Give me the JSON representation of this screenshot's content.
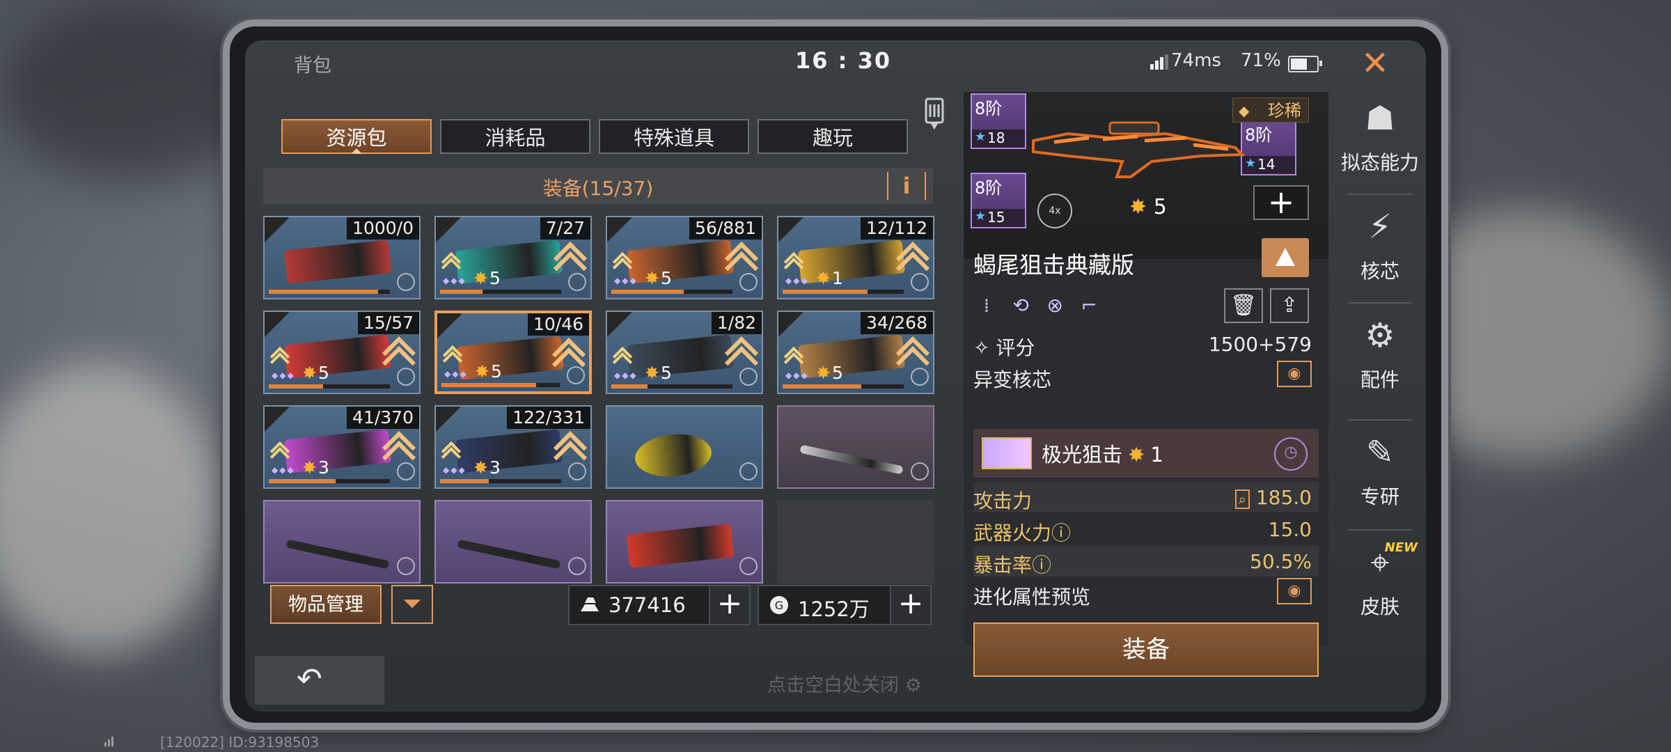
{
  "header": {
    "title": "背包",
    "clock": "16 : 30",
    "ping": "74ms",
    "battery": "71%",
    "battery_level": 0.71
  },
  "tabs": [
    {
      "label": "资源包",
      "active": true
    },
    {
      "label": "消耗品",
      "active": false
    },
    {
      "label": "特殊道具",
      "active": false
    },
    {
      "label": "趣玩",
      "active": false
    }
  ],
  "equipment": {
    "header": "装备(15/37)",
    "info_label": "i",
    "items": [
      {
        "count": "1000/0",
        "stars": "",
        "tier": "blue",
        "weapon": "fire-extinguisher",
        "progress": 0.9,
        "color": "#b53a36"
      },
      {
        "count": "7/27",
        "stars": "5",
        "tier": "blue",
        "weapon": "rifle-teal",
        "progress": 0.35,
        "color": "#2aa39a"
      },
      {
        "count": "56/881",
        "stars": "5",
        "tier": "blue",
        "weapon": "rifle-orange",
        "progress": 0.6,
        "color": "#c9652f"
      },
      {
        "count": "12/112",
        "stars": "1",
        "tier": "blue",
        "weapon": "rifle-gold",
        "progress": 0.7,
        "color": "#d7a530"
      },
      {
        "count": "15/57",
        "stars": "5",
        "tier": "blue",
        "weapon": "rifle-red",
        "progress": 0.45,
        "color": "#d63a3a"
      },
      {
        "count": "10/46",
        "stars": "5",
        "tier": "blue",
        "weapon": "sniper-scorpion",
        "progress": 0.8,
        "color": "#c9652f",
        "selected": true
      },
      {
        "count": "1/82",
        "stars": "5",
        "tier": "blue",
        "weapon": "crossbow-dark",
        "progress": 0.3,
        "color": "#3d4b5a"
      },
      {
        "count": "34/268",
        "stars": "5",
        "tier": "blue",
        "weapon": "rifle-camo",
        "progress": 0.65,
        "color": "#b48148"
      },
      {
        "count": "41/370",
        "stars": "3",
        "tier": "blue",
        "weapon": "rifle-pink",
        "progress": 0.55,
        "color": "#c44bd0"
      },
      {
        "count": "122/331",
        "stars": "3",
        "tier": "blue",
        "weapon": "launcher-blue",
        "progress": 0.4,
        "color": "#2f3c66"
      },
      {
        "count": "",
        "stars": "",
        "tier": "blue",
        "weapon": "disc-saw",
        "progress": 0,
        "color": "#d8bf28"
      },
      {
        "count": "",
        "stars": "",
        "tier": "dim",
        "weapon": "screwdriver",
        "progress": 0,
        "color": "#cfcfcf"
      },
      {
        "count": "",
        "stars": "",
        "tier": "purple",
        "weapon": "hammer",
        "progress": 0,
        "color": "#2a2a2a"
      },
      {
        "count": "",
        "stars": "",
        "tier": "purple",
        "weapon": "hammer",
        "progress": 0,
        "color": "#2a2a2a"
      },
      {
        "count": "",
        "stars": "",
        "tier": "purple",
        "weapon": "chainsaw",
        "progress": 0,
        "color": "#d33a2a"
      },
      {
        "count": "",
        "stars": "",
        "tier": "empty",
        "weapon": "",
        "progress": 0,
        "color": ""
      }
    ]
  },
  "bottom": {
    "manage_label": "物品管理",
    "gold_value": "377416",
    "coin_value": "1252万",
    "plus": "+",
    "dismiss_hint": "点击空白处关闭",
    "back_icon": "undo-icon"
  },
  "detail": {
    "rarity": "珍稀",
    "tiers": [
      {
        "label": "8阶",
        "stars": "18"
      },
      {
        "label": "8阶",
        "stars": "15"
      },
      {
        "label": "8阶",
        "stars": "14"
      }
    ],
    "scope": "4x",
    "star_level": "5",
    "plus": "+",
    "weapon_name": "蝎尾狙击典藏版",
    "score_label": "评分",
    "score_value": "1500+579",
    "mutation_label": "异变核芯",
    "core_name": "极光狙击",
    "core_star": "1",
    "stats": [
      {
        "label": "攻击力",
        "value": "185.0"
      },
      {
        "label": "武器火力ⓘ",
        "value": "15.0"
      },
      {
        "label": "暴击率ⓘ",
        "value": "50.5%"
      }
    ],
    "evolve_label": "进化属性预览",
    "equip_label": "装备"
  },
  "sidebar": [
    {
      "label": "拟态能力",
      "icon": "mimic-icon"
    },
    {
      "label": "核芯",
      "icon": "core-icon"
    },
    {
      "label": "配件",
      "icon": "parts-icon"
    },
    {
      "label": "专研",
      "icon": "research-icon"
    },
    {
      "label": "皮肤",
      "icon": "skin-icon",
      "new": "NEW"
    }
  ],
  "footer": {
    "id_text": "[120022] ID:93198503"
  }
}
